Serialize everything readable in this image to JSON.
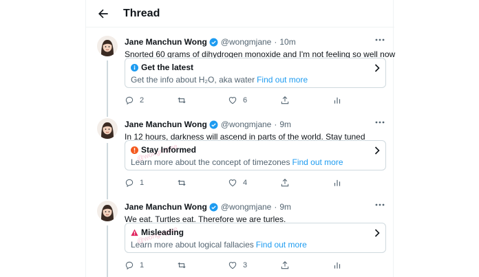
{
  "header": {
    "title": "Thread"
  },
  "colors": {
    "link": "#1d9bf0",
    "verified": "#1d9bf0",
    "info": "#1d9bf0",
    "warning": "#f4591e",
    "misleading": "#e0245e"
  },
  "tweets": [
    {
      "name": "Jane Manchun Wong",
      "handle": "@wongmjane",
      "sep": "·",
      "time": "10m",
      "text": "Snorted 60 grams of dihydrogen monoxide and I'm not feeling so well now",
      "card": {
        "icon": "info-icon",
        "title": "Get the latest",
        "subtitle": "Get the info about H₂O, aka water",
        "link": "Find out more"
      },
      "replies": "2",
      "retweets": "",
      "likes": "6"
    },
    {
      "name": "Jane Manchun Wong",
      "handle": "@wongmjane",
      "sep": "·",
      "time": "9m",
      "text": "In 12 hours, darkness will ascend in parts of the world. Stay tuned",
      "card": {
        "icon": "exclamation-icon",
        "title": "Stay Informed",
        "subtitle": "Learn more about the concept of timezones",
        "link": "Find out more",
        "watermark": "@wongmjane"
      },
      "replies": "1",
      "retweets": "",
      "likes": "4"
    },
    {
      "name": "Jane Manchun Wong",
      "handle": "@wongmjane",
      "sep": "·",
      "time": "9m",
      "text": "We eat. Turtles eat. Therefore we are turles.",
      "card": {
        "icon": "warning-triangle-icon",
        "title": "Misleading",
        "subtitle": "Learn more about logical fallacies",
        "link": "Find out more",
        "watermark": "@wongmjane"
      },
      "replies": "1",
      "retweets": "",
      "likes": "3"
    }
  ]
}
